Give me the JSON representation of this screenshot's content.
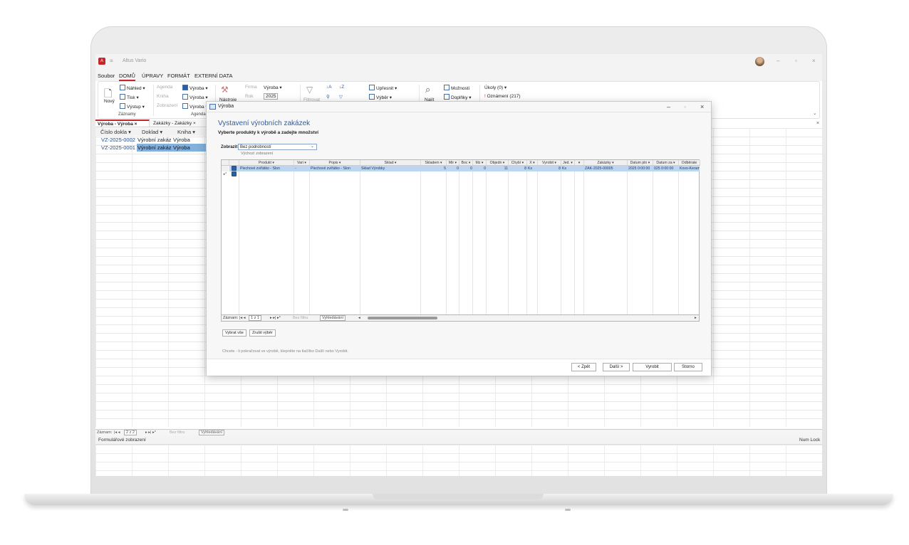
{
  "app": {
    "title": "Altus Vario",
    "win_minimize": "–",
    "win_maximize": "▫",
    "win_close": "×"
  },
  "menu": [
    "Soubor",
    "DOMŮ",
    "ÚPRAVY",
    "FORMÁT",
    "EXTERNÍ DATA"
  ],
  "ribbon": {
    "novy": "Nový",
    "nahled": "Náhled ▾",
    "tisk": "Tisk ▾",
    "vystup": "Výstup ▾",
    "group_zaznamy": "Záznamy",
    "agenda": "Agenda",
    "kniha": "Kniha",
    "zobrazeni": "Zobrazení",
    "vyroba1": "Výroba ▾",
    "vyroba2": "Výroba ▾",
    "vyroba3": "Výroba ▾",
    "group_agenda": "Agenda",
    "firma": "Firma",
    "firma_val": "Výroba ▾",
    "rok": "Rok",
    "rok_val": "2025",
    "nastroje": "Nástroje",
    "zpresnit": "Upřesnit ▾",
    "vyber": "Výběr ▾",
    "filtr": "Filtrovat",
    "najit": "Najít",
    "moznosti": "Možnosti",
    "doplnky": "Doplňky ▾",
    "ukoly": "Úkoly (0)",
    "ukoly_arrow": "▾",
    "oznameni": "Oznámení (217)"
  },
  "tabs": [
    {
      "label": "Výroba - Výroba",
      "close": "×"
    },
    {
      "label": "Zakázky - Zakázky",
      "close": "×"
    }
  ],
  "main_grid": {
    "headers": [
      "Číslo dokla ▾",
      "Doklad ▾",
      "Kniha ▾"
    ],
    "rows": [
      [
        "VZ-2025-0002",
        "Výrobní zakáz",
        "Výroba"
      ],
      [
        "VZ-2025-0001",
        "Výrobní zakáz",
        "Výroba"
      ]
    ]
  },
  "status": {
    "record_label": "Záznam:",
    "record_pos": "2 z 2",
    "nofilter": "Bez filtru",
    "search": "Vyhledávání",
    "view": "Formulářové zobrazení",
    "numlock": "Num Lock"
  },
  "dialog": {
    "title": "Výroba",
    "heading": "Vystavení výrobních zakázek",
    "subheading": "Vyberte produkty k výrobě a zadejte množství",
    "show_label": "Zobrazit",
    "show_value": "Bez podrobností",
    "show_hint": "Výchozí zobrazení",
    "headers": [
      "",
      "Produkt ▾",
      "Vari ▾",
      "Popis ▾",
      "Sklad ▾",
      "Skladem ▾",
      "Mir ▾",
      "Boc ▾",
      "Mz ▾",
      "Objedn ▾",
      "Chybí ▾",
      "X ▾",
      "Vyrobit ▾",
      "Jed. ▾",
      "▾",
      "Zakázky ▾",
      "Datum pln ▾",
      "Datum za ▾",
      "Odběrate"
    ],
    "row": [
      "",
      "Plechové zvířátko - Slon",
      "-",
      "Plechové zvířátko - Slon",
      "Sklad Výrobky",
      "5",
      "0",
      "0",
      "0",
      "11",
      "8",
      "Ks",
      "8",
      "Ks",
      "",
      "ZAK-2025-00005",
      "2025 0:00:00",
      "025 0:00:00",
      "Kovo-Keramik"
    ],
    "nav_label": "Záznam:",
    "nav_pos": "1 z 1",
    "nav_nofilter": "Bez filtru",
    "nav_search": "Vyhledávání",
    "btn_select_all": "Vybrat vše",
    "btn_clear": "Zrušit výběr",
    "hint": "Chcete - li pokračovat ve výrobě, klepněte na tlačítko Další nebo Vyrobit.",
    "btn_back": "< Zpět",
    "btn_next": "Další >",
    "btn_produce": "Vyrobit",
    "btn_cancel": "Storno"
  }
}
